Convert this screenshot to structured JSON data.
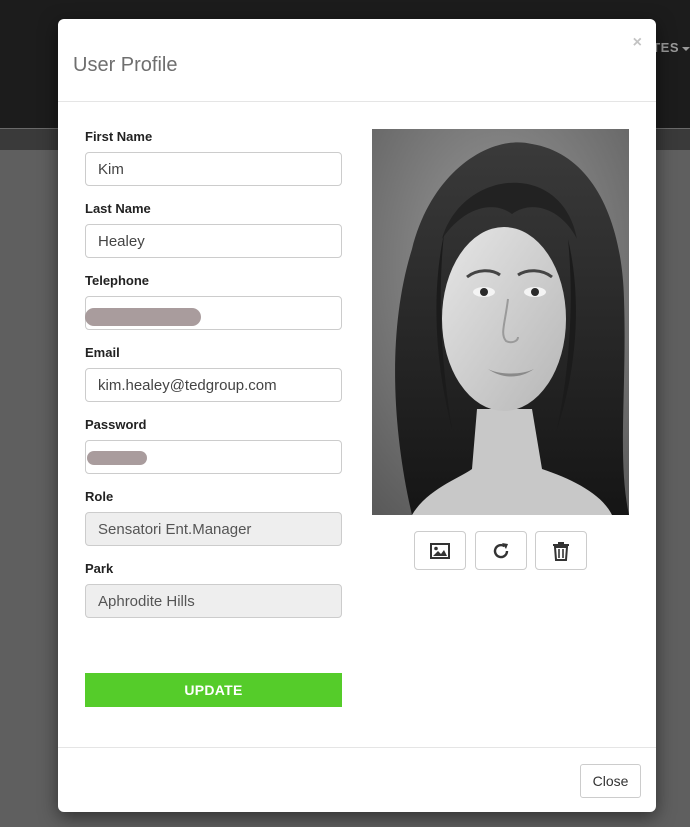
{
  "background": {
    "nav_partial_label": "TES"
  },
  "modal": {
    "title": "User Profile",
    "close_x": "×"
  },
  "form": {
    "first_name": {
      "label": "First Name",
      "value": "Kim"
    },
    "last_name": {
      "label": "Last Name",
      "value": "Healey"
    },
    "telephone": {
      "label": "Telephone",
      "value": ""
    },
    "email": {
      "label": "Email",
      "value": "kim.healey@tedgroup.com"
    },
    "password": {
      "label": "Password",
      "value": ""
    },
    "role": {
      "label": "Role",
      "value": "Sensatori Ent.Manager"
    },
    "park": {
      "label": "Park",
      "value": "Aphrodite Hills"
    },
    "update_label": "UPDATE"
  },
  "photo_actions": {
    "icons": [
      "image-icon",
      "refresh-icon",
      "trash-icon"
    ]
  },
  "footer": {
    "close_label": "Close"
  },
  "colors": {
    "update_button": "#55cc2a",
    "backdrop": "#5e5e5e",
    "redaction": "#a49798"
  }
}
